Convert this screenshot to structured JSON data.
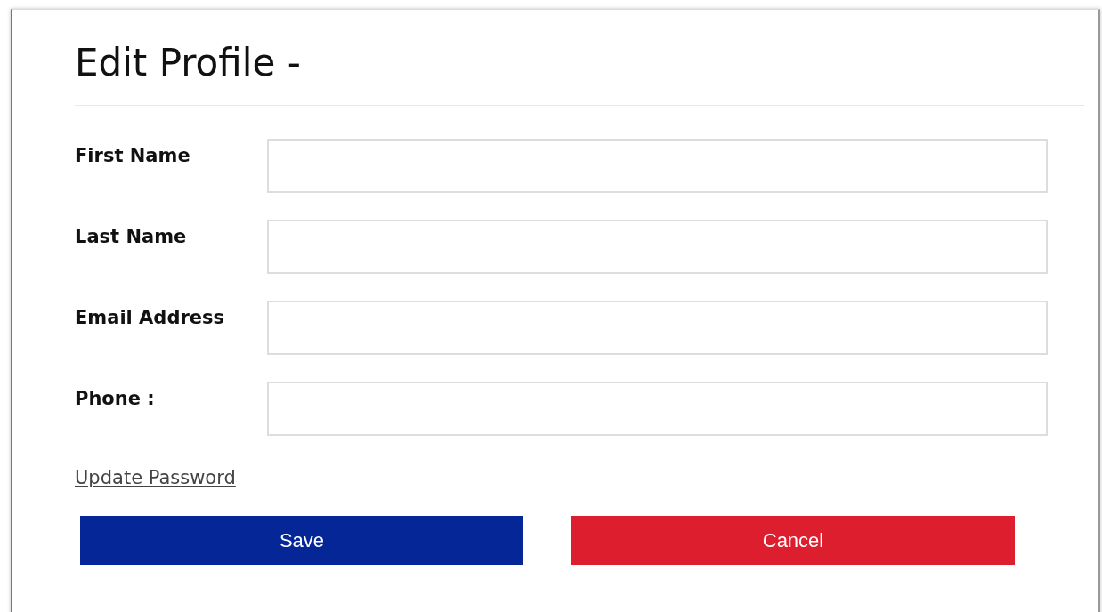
{
  "title": "Edit Profile -",
  "fields": [
    {
      "label": "First Name"
    },
    {
      "label": "Last Name"
    },
    {
      "label": "Email Address"
    },
    {
      "label": "Phone :"
    }
  ],
  "link": "Update Password",
  "buttons": [
    {
      "label": "Save",
      "kind": "primary"
    },
    {
      "label": "Cancel",
      "kind": "danger"
    }
  ]
}
